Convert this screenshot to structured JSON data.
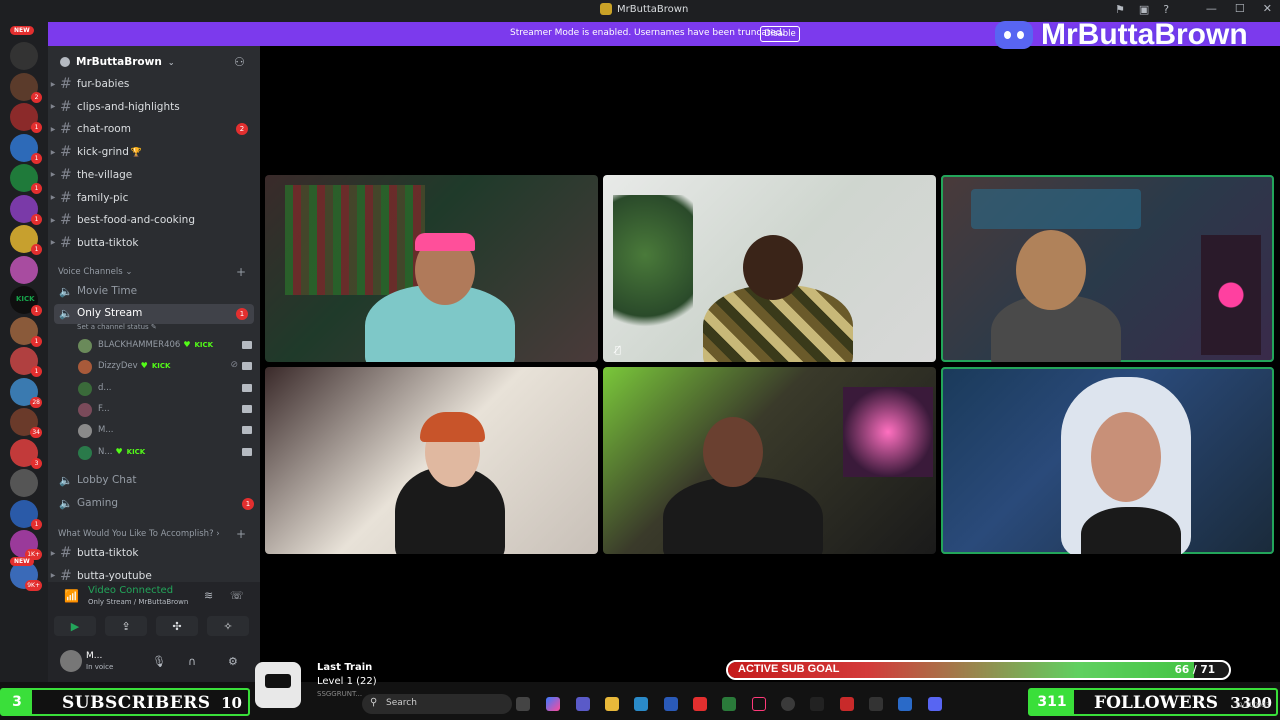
{
  "window": {
    "title": "MrButtaBrown"
  },
  "banner": {
    "message": "Streamer Mode is enabled. Usernames have been truncated.",
    "disable_label": "Disable"
  },
  "watermark": {
    "text": "MrButtaBrown"
  },
  "rail": {
    "new_label": "NEW",
    "new_label_bottom": "NEW",
    "servers": [
      {
        "color": "#333",
        "badge": ""
      },
      {
        "color": "#5b3b2b",
        "badge": "2"
      },
      {
        "color": "#8b2a2a",
        "badge": "1"
      },
      {
        "color": "#2d6ab8",
        "badge": "1"
      },
      {
        "color": "#1f7a3a",
        "badge": "1"
      },
      {
        "color": "#7a3aa8",
        "badge": "1"
      },
      {
        "color": "#c7a02e",
        "badge": "1"
      },
      {
        "color": "#a84ca0",
        "badge": ""
      },
      {
        "color": "#0f0f0f",
        "badge": "1",
        "text": "KICK"
      },
      {
        "color": "#8a5a3a",
        "badge": "1"
      },
      {
        "color": "#b04040",
        "badge": "1"
      },
      {
        "color": "#3a7ab0",
        "badge": "28"
      },
      {
        "color": "#6a3a2a",
        "badge": "34"
      },
      {
        "color": "#c23a3a",
        "badge": "3"
      },
      {
        "color": "#555",
        "badge": ""
      },
      {
        "color": "#2a5aa8",
        "badge": "1"
      },
      {
        "color": "#9a3a9a",
        "badge": "1K+"
      },
      {
        "color": "#3a6ab8",
        "badge": "9K+"
      }
    ]
  },
  "sidebar": {
    "server_name": "MrButtaBrown",
    "text_channels": [
      {
        "name": "fur-babies",
        "badge": ""
      },
      {
        "name": "clips-and-highlights",
        "badge": ""
      },
      {
        "name": "chat-room",
        "badge": "2"
      },
      {
        "name": "kick-grind",
        "badge": "",
        "emoji": "🏆"
      },
      {
        "name": "the-village",
        "badge": ""
      },
      {
        "name": "family-pic",
        "badge": ""
      },
      {
        "name": "best-food-and-cooking",
        "badge": ""
      },
      {
        "name": "butta-tiktok",
        "badge": ""
      }
    ],
    "voice_category": "Voice Channels",
    "voice_channels": {
      "movie_time": "Movie Time",
      "only_stream": "Only Stream",
      "only_stream_badge": "1",
      "channel_status": "Set a channel status",
      "lobby_chat": "Lobby Chat",
      "gaming": "Gaming",
      "gaming_badge": "1"
    },
    "voice_users": [
      {
        "name": "BLACKHAMMER406",
        "heart": true,
        "kick": "KICK",
        "avatar": "#6a8a5a",
        "muted": false
      },
      {
        "name": "DizzyDev",
        "heart": true,
        "kick": "KICK",
        "avatar": "#a85a3a",
        "muted": true
      },
      {
        "name": "d...",
        "heart": false,
        "kick": "",
        "avatar": "#3a6a3a",
        "muted": false
      },
      {
        "name": "F...",
        "heart": false,
        "kick": "",
        "avatar": "#7a4a5a",
        "muted": false
      },
      {
        "name": "M...",
        "heart": false,
        "kick": "",
        "avatar": "#8a8a8a",
        "muted": false
      },
      {
        "name": "N...",
        "heart": true,
        "kick": "KICK",
        "avatar": "#2a7a4a",
        "muted": false
      }
    ],
    "category2": "What Would You Like To Accomplish?",
    "category2_channels": [
      {
        "name": "butta-tiktok"
      },
      {
        "name": "butta-youtube"
      }
    ]
  },
  "voice_panel": {
    "title": "Video Connected",
    "subtitle": "Only Stream / MrButtaBrown"
  },
  "user_panel": {
    "name": "M...",
    "status": "In voice"
  },
  "overlay": {
    "subscribers": {
      "count": "3",
      "label": "SUBSCRIBERS",
      "goal": "10"
    },
    "followers": {
      "count": "311",
      "label": "FOLLOWERS",
      "goal": "3300"
    },
    "train": {
      "title": "Last Train",
      "level": "Level 1 (22)",
      "user": "SSGGRUNT..."
    },
    "sub_goal": {
      "label": "ACTIVE SUB GOAL",
      "value": "66 / 71",
      "progress": 0.93
    }
  },
  "taskbar": {
    "search_placeholder": "Search",
    "clock": "12/11/2023"
  },
  "colors": {
    "banner": "#7c3aed",
    "speaking": "#23a55a",
    "overlay_green": "#3adf3a",
    "badge_red": "#e32f2f",
    "kick_green": "#53fc18"
  }
}
